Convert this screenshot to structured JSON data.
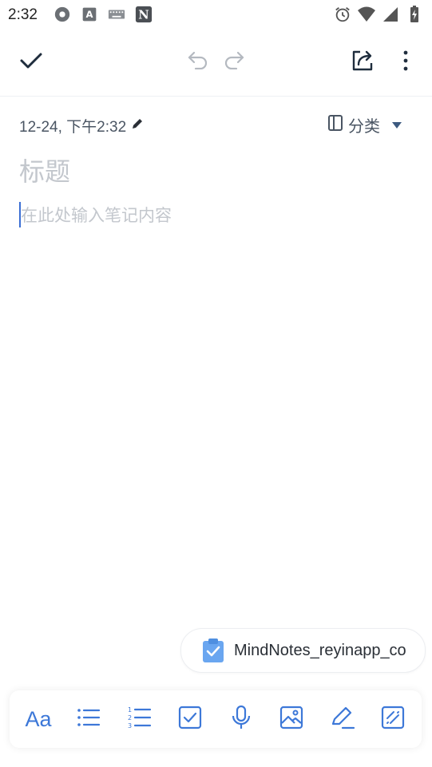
{
  "status_bar": {
    "time": "2:32",
    "icons_left": [
      "settings-gear-icon",
      "font-a-icon",
      "keyboard-icon",
      "notion-n-icon"
    ],
    "icons_right": [
      "alarm-icon",
      "wifi-icon",
      "signal-icon",
      "battery-charging-icon"
    ]
  },
  "toolbar": {
    "icons": [
      "check-icon",
      "undo-icon",
      "redo-icon",
      "share-icon",
      "more-vertical-icon"
    ]
  },
  "note": {
    "date": "12-24, 下午2:32",
    "category_label": "分类",
    "title_placeholder": "标题",
    "body_placeholder": "在此处输入笔记内容"
  },
  "clipboard_chip": {
    "text": "MindNotes_reyinapp_co"
  },
  "bottom_toolbar": {
    "text_format_label": "Aa",
    "icons": [
      "text-format-icon",
      "bullet-list-icon",
      "numbered-list-icon",
      "checkbox-icon",
      "microphone-icon",
      "image-icon",
      "pen-icon",
      "pattern-icon"
    ]
  },
  "colors": {
    "accent": "#3d78d8",
    "title_text": "#1f2d3d",
    "placeholder": "#c3c7cd",
    "meta_text": "#4a5563",
    "caret": "#3b6fd4"
  }
}
